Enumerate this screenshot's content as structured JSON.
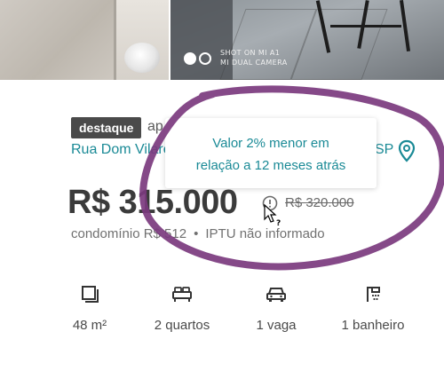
{
  "gallery": {
    "watermark_line1": "SHOT ON MI A1",
    "watermark_line2": "MI DUAL CAMERA",
    "dots_total": 2,
    "dots_active": 1
  },
  "listing": {
    "badge": "destaque",
    "type_partial": "ap",
    "address_start": "Rua Dom Vilare",
    "address_end": "SP",
    "price": "R$ 315.000",
    "old_price": "R$ 320.000",
    "fees_condo": "condomínio R$ 512",
    "fees_sep": "•",
    "fees_iptu": "IPTU não informado"
  },
  "tooltip": {
    "line1": "Valor 2% menor em",
    "line2": "relação a 12 meses atrás"
  },
  "features": [
    {
      "icon": "area-icon",
      "label": "48 m²"
    },
    {
      "icon": "bed-icon",
      "label": "2 quartos"
    },
    {
      "icon": "car-icon",
      "label": "1 vaga"
    },
    {
      "icon": "shower-icon",
      "label": "1 banheiro"
    }
  ],
  "colors": {
    "accent": "#1a8a96",
    "annotation": "#7b3a7e",
    "badge_bg": "#4a4a4a"
  }
}
